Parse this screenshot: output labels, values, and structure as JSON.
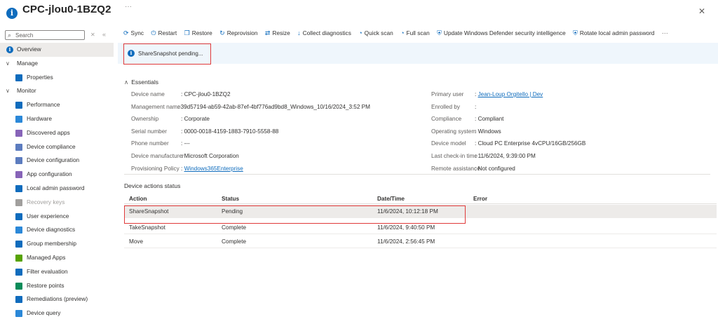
{
  "header": {
    "title": "CPC-jlou0-1BZQ2",
    "more": "···",
    "close": "✕"
  },
  "sidebar": {
    "search_placeholder": "Search",
    "clear": "✕",
    "collapse": "«",
    "items": [
      {
        "label": "Overview",
        "level": 0,
        "icon": "info-icon",
        "color": "#0f6cbd",
        "active": true
      },
      {
        "label": "Manage",
        "level": 0,
        "icon": "chevron-down-icon"
      },
      {
        "label": "Properties",
        "level": 1,
        "icon": "properties-icon",
        "color": "#0f6cbd"
      },
      {
        "label": "Monitor",
        "level": 0,
        "icon": "chevron-down-icon"
      },
      {
        "label": "Performance",
        "level": 1,
        "icon": "performance-icon",
        "color": "#0f6cbd"
      },
      {
        "label": "Hardware",
        "level": 1,
        "icon": "hardware-icon",
        "color": "#2b88d8"
      },
      {
        "label": "Discovered apps",
        "level": 1,
        "icon": "apps-icon",
        "color": "#8764b8"
      },
      {
        "label": "Device compliance",
        "level": 1,
        "icon": "compliance-icon",
        "color": "#5c7cbf"
      },
      {
        "label": "Device configuration",
        "level": 1,
        "icon": "configuration-icon",
        "color": "#5c7cbf"
      },
      {
        "label": "App configuration",
        "level": 1,
        "icon": "app-config-icon",
        "color": "#8764b8"
      },
      {
        "label": "Local admin password",
        "level": 1,
        "icon": "password-icon",
        "color": "#0f6cbd"
      },
      {
        "label": "Recovery keys",
        "level": 1,
        "icon": "key-icon",
        "color": "#a19f9d",
        "disabled": true
      },
      {
        "label": "User experience",
        "level": 1,
        "icon": "user-experience-icon",
        "color": "#0f6cbd"
      },
      {
        "label": "Device diagnostics",
        "level": 1,
        "icon": "diagnostics-icon",
        "color": "#2b88d8"
      },
      {
        "label": "Group membership",
        "level": 1,
        "icon": "group-icon",
        "color": "#0f6cbd"
      },
      {
        "label": "Managed Apps",
        "level": 1,
        "icon": "managed-apps-icon",
        "color": "#57a300"
      },
      {
        "label": "Filter evaluation",
        "level": 1,
        "icon": "filter-icon",
        "color": "#0f6cbd"
      },
      {
        "label": "Restore points",
        "level": 1,
        "icon": "restore-points-icon",
        "color": "#0a8c5a"
      },
      {
        "label": "Remediations (preview)",
        "level": 1,
        "icon": "remediations-icon",
        "color": "#0f6cbd"
      },
      {
        "label": "Device query",
        "level": 1,
        "icon": "query-icon",
        "color": "#2b88d8"
      }
    ]
  },
  "toolbar": {
    "sync": "Sync",
    "restart": "Restart",
    "restore": "Restore",
    "reprovision": "Reprovision",
    "resize": "Resize",
    "collect_diagnostics": "Collect diagnostics",
    "quick_scan": "Quick scan",
    "full_scan": "Full scan",
    "update_defender": "Update Windows Defender security intelligence",
    "rotate_password": "Rotate local admin password",
    "more": "···"
  },
  "banner": {
    "text": "ShareSnapshot pending..."
  },
  "essentials": {
    "heading": "Essentials",
    "left": [
      {
        "key": "Device name",
        "value": "CPC-jlou0-1BZQ2"
      },
      {
        "key": "Management name",
        "value": "39d57194-ab59-42ab-87ef-4bf776ad9bd8_Windows_10/16/2024_3:52 PM"
      },
      {
        "key": "Ownership",
        "value": "Corporate"
      },
      {
        "key": "Serial number",
        "value": "0000-0018-4159-1883-7910-5558-88"
      },
      {
        "key": "Phone number",
        "value": "---"
      },
      {
        "key": "Device manufacturer",
        "value": "Microsoft Corporation"
      },
      {
        "key": "Provisioning Policy",
        "value": "Windows365Enterprise",
        "link": true
      }
    ],
    "right": [
      {
        "key": "Primary user",
        "value": "Jean-Loup Orgitello | Dev",
        "link": true
      },
      {
        "key": "Enrolled by",
        "value": ""
      },
      {
        "key": "Compliance",
        "value": "Compliant"
      },
      {
        "key": "Operating system",
        "value": "Windows"
      },
      {
        "key": "Device model",
        "value": "Cloud PC Enterprise 4vCPU/16GB/256GB"
      },
      {
        "key": "Last check-in time",
        "value": "11/6/2024, 9:39:00 PM"
      },
      {
        "key": "Remote assistance",
        "value": "Not configured"
      }
    ]
  },
  "actions_status": {
    "title": "Device actions status",
    "columns": [
      "Action",
      "Status",
      "Date/Time",
      "Error"
    ],
    "rows": [
      {
        "action": "ShareSnapshot",
        "status": "Pending",
        "datetime": "11/6/2024, 10:12:18 PM",
        "error": ""
      },
      {
        "action": "TakeSnapshot",
        "status": "Complete",
        "datetime": "11/6/2024, 9:40:50 PM",
        "error": ""
      },
      {
        "action": "Move",
        "status": "Complete",
        "datetime": "11/6/2024, 2:56:45 PM",
        "error": ""
      }
    ]
  }
}
